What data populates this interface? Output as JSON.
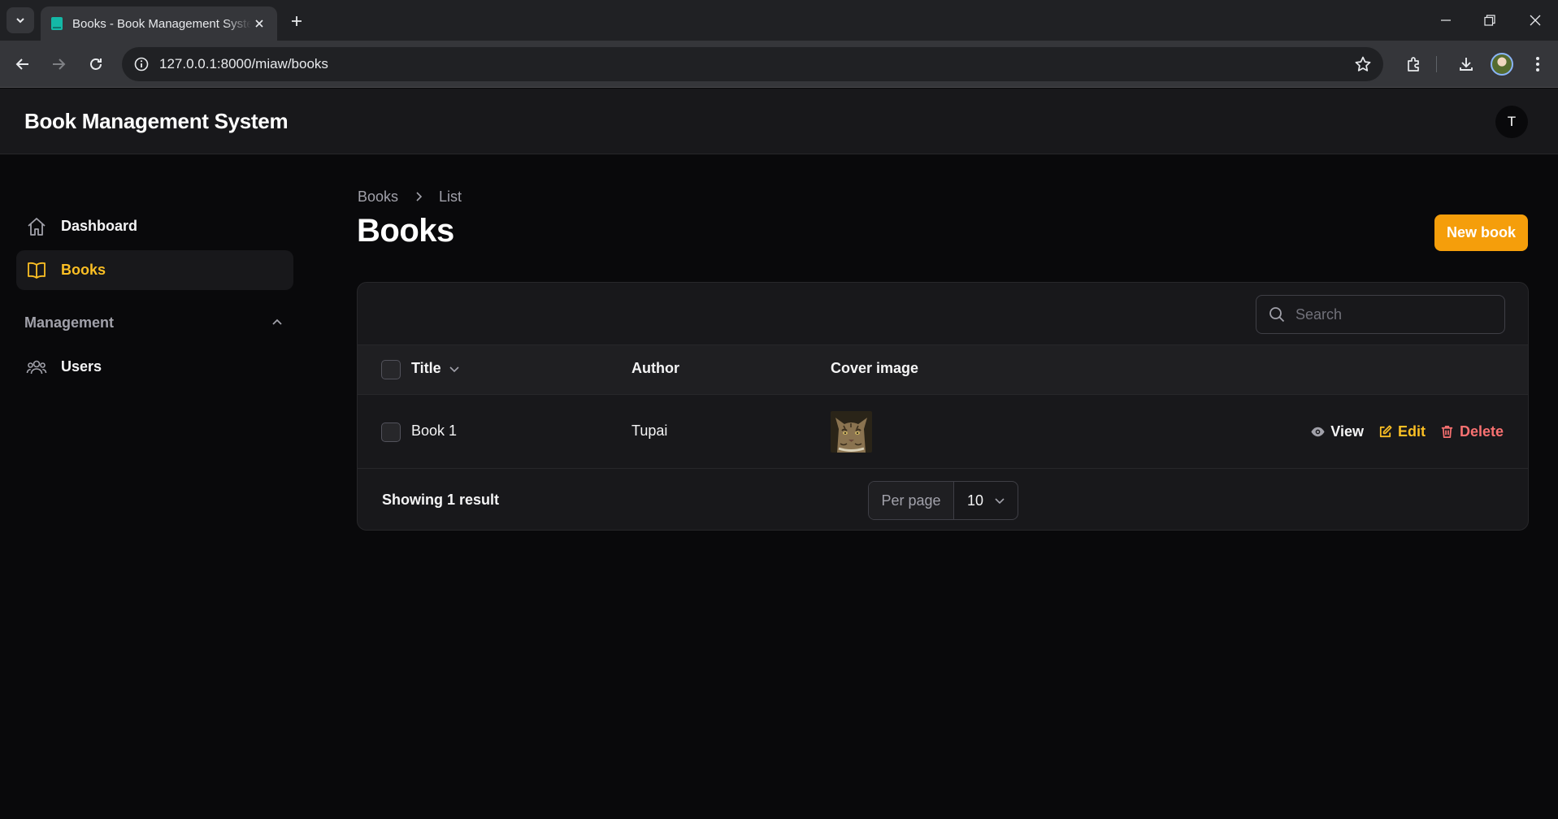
{
  "browser": {
    "tab_title": "Books - Book Management System",
    "url": "127.0.0.1:8000/miaw/books"
  },
  "header": {
    "brand": "Book Management System",
    "avatar_initial": "T"
  },
  "sidebar": {
    "items": [
      {
        "label": "Dashboard",
        "icon": "home-icon",
        "active": false
      },
      {
        "label": "Books",
        "icon": "book-open-icon",
        "active": true
      }
    ],
    "group": {
      "label": "Management",
      "expanded": true,
      "items": [
        {
          "label": "Users",
          "icon": "users-icon"
        }
      ]
    }
  },
  "page": {
    "breadcrumb": [
      "Books",
      "List"
    ],
    "title": "Books",
    "new_button": "New book"
  },
  "table": {
    "search_placeholder": "Search",
    "columns": [
      "Title",
      "Author",
      "Cover image"
    ],
    "sort_column": "Title",
    "rows": [
      {
        "title": "Book 1",
        "author": "Tupai",
        "cover": "cat-photo"
      }
    ],
    "actions": {
      "view": "View",
      "edit": "Edit",
      "delete": "Delete"
    },
    "footer": {
      "showing": "Showing 1 result",
      "per_page_label": "Per page",
      "per_page_value": "10"
    }
  },
  "colors": {
    "accent": "#f59e0b",
    "accent_text": "#fbbf24",
    "danger": "#f87171",
    "background": "#09090b",
    "surface": "#18181b"
  }
}
